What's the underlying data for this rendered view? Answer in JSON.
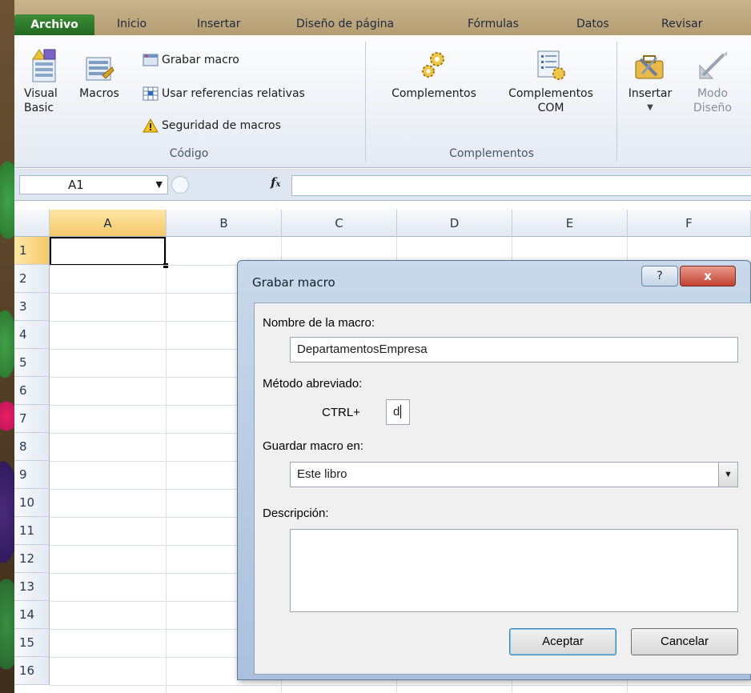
{
  "ribbon": {
    "tabs": [
      "Archivo",
      "Inicio",
      "Insertar",
      "Diseño de página",
      "Fórmulas",
      "Datos",
      "Revisar"
    ],
    "groups": {
      "codigo": {
        "label": "Código",
        "visual_basic": "Visual\nBasic",
        "macros": "Macros",
        "grabar_macro": "Grabar macro",
        "usar_referencias": "Usar referencias relativas",
        "seguridad": "Seguridad de macros"
      },
      "complementos": {
        "label": "Complementos",
        "complementos": "Complementos",
        "complementos_com": "Complementos\nCOM"
      },
      "controles": {
        "insertar": "Insertar",
        "modo_diseno": "Modo\nDiseño"
      }
    }
  },
  "formula_bar": {
    "name_box": "A1",
    "fx": "fx",
    "value": ""
  },
  "grid": {
    "columns": [
      "A",
      "B",
      "C",
      "D",
      "E",
      "F"
    ],
    "rows": [
      "1",
      "2",
      "3",
      "4",
      "5",
      "6",
      "7",
      "8",
      "9",
      "10",
      "11",
      "12",
      "13",
      "14",
      "15",
      "16"
    ],
    "active_cell": "A1"
  },
  "dialog": {
    "title": "Grabar macro",
    "help": "?",
    "close": "x",
    "nombre_label": "Nombre de la macro:",
    "nombre_value": "DepartamentosEmpresa",
    "metodo_label": "Método abreviado:",
    "ctrl_label": "CTRL+",
    "shortcut_value": "d",
    "guardar_label": "Guardar macro en:",
    "guardar_value": "Este libro",
    "descripcion_label": "Descripción:",
    "descripcion_value": "",
    "aceptar": "Aceptar",
    "cancelar": "Cancelar"
  },
  "colors": {
    "archivo_tab": "#2f7d2b",
    "ribbon": "#e4eaf3",
    "header_active": "#f6c86a",
    "dialog_frame": "#aac0dd",
    "close_button": "#c2432f"
  }
}
